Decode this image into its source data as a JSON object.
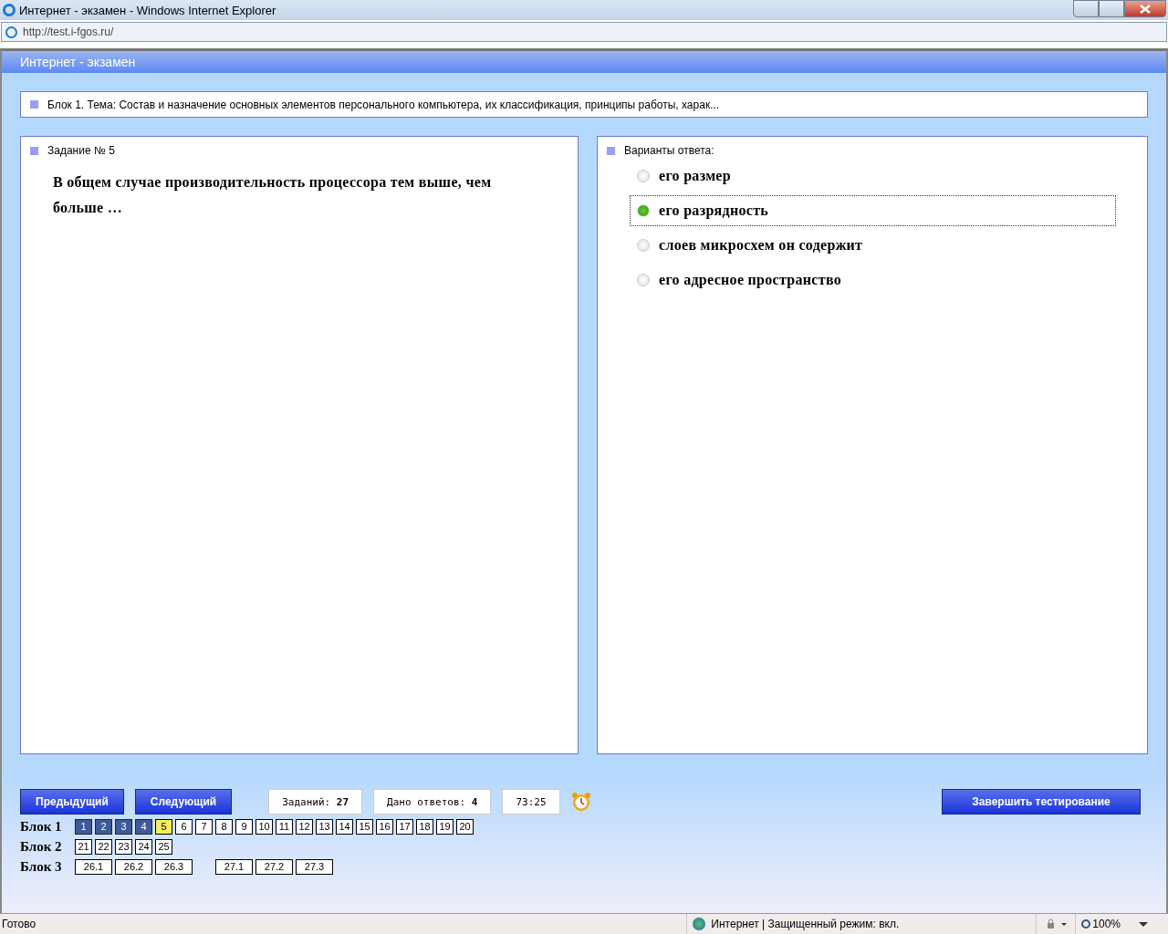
{
  "window": {
    "title": "Интернет - экзамен - Windows Internet Explorer",
    "address": "http://test.i-fgos.ru/"
  },
  "app": {
    "title": "Интернет - экзамен"
  },
  "topic": "Блок 1. Тема: Состав и назначение основных элементов персонального компьютера, их классификация, принципы работы, харак...",
  "task": {
    "heading": "Задание № 5",
    "text": "В общем случае производительность процессора тем выше, чем больше …"
  },
  "answers": {
    "heading": "Варианты ответа:",
    "options": [
      {
        "label": "его размер",
        "selected": false
      },
      {
        "label": "его разрядность",
        "selected": true
      },
      {
        "label": "слоев микросхем он содержит",
        "selected": false
      },
      {
        "label": "его адресное пространство",
        "selected": false
      }
    ]
  },
  "footer": {
    "prev": "Предыдущий",
    "next": "Следующий",
    "tasks": "Заданий: **27**",
    "given": "Дано ответов: **4**",
    "timer": "73:25",
    "finish": "Завершить тестирование"
  },
  "blocks": [
    {
      "label": "Блок 1",
      "groups": [
        [
          {
            "n": "1",
            "answered": true,
            "selected": false
          },
          {
            "n": "2",
            "answered": true,
            "selected": false
          },
          {
            "n": "3",
            "answered": true,
            "selected": false
          },
          {
            "n": "4",
            "answered": true,
            "selected": false
          },
          {
            "n": "5",
            "answered": false,
            "selected": true
          },
          {
            "n": "6",
            "answered": false,
            "selected": false
          },
          {
            "n": "7",
            "answered": false,
            "selected": false
          },
          {
            "n": "8",
            "answered": false,
            "selected": false
          },
          {
            "n": "9",
            "answered": false,
            "selected": false
          },
          {
            "n": "10",
            "answered": false,
            "selected": false
          },
          {
            "n": "11",
            "answered": false,
            "selected": false
          },
          {
            "n": "12",
            "answered": false,
            "selected": false
          },
          {
            "n": "13",
            "answered": false,
            "selected": false
          },
          {
            "n": "14",
            "answered": false,
            "selected": false
          },
          {
            "n": "15",
            "answered": false,
            "selected": false
          },
          {
            "n": "16",
            "answered": false,
            "selected": false
          },
          {
            "n": "17",
            "answered": false,
            "selected": false
          },
          {
            "n": "18",
            "answered": false,
            "selected": false
          },
          {
            "n": "19",
            "answered": false,
            "selected": false
          },
          {
            "n": "20",
            "answered": false,
            "selected": false
          }
        ]
      ]
    },
    {
      "label": "Блок 2",
      "groups": [
        [
          {
            "n": "21",
            "answered": false,
            "selected": false
          },
          {
            "n": "22",
            "answered": false,
            "selected": false
          },
          {
            "n": "23",
            "answered": false,
            "selected": false
          },
          {
            "n": "24",
            "answered": false,
            "selected": false
          },
          {
            "n": "25",
            "answered": false,
            "selected": false
          }
        ]
      ]
    },
    {
      "label": "Блок 3",
      "groups": [
        [
          {
            "n": "26.1",
            "answered": false,
            "selected": false
          },
          {
            "n": "26.2",
            "answered": false,
            "selected": false
          },
          {
            "n": "26.3",
            "answered": false,
            "selected": false
          }
        ],
        [
          {
            "n": "27.1",
            "answered": false,
            "selected": false
          },
          {
            "n": "27.2",
            "answered": false,
            "selected": false
          },
          {
            "n": "27.3",
            "answered": false,
            "selected": false
          }
        ]
      ]
    }
  ],
  "status_bar": {
    "text": "Готово",
    "zone": "Интернет | Защищенный режим: вкл.",
    "zoom": "100%"
  }
}
